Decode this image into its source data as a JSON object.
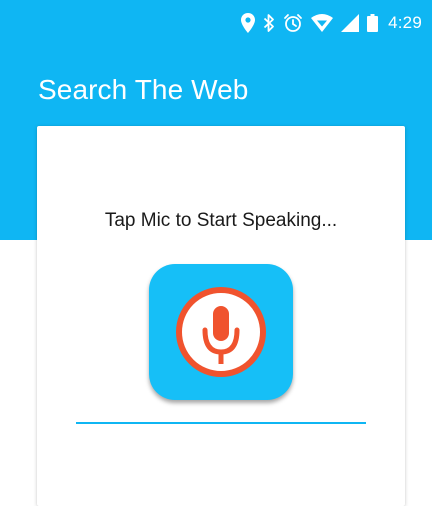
{
  "status_bar": {
    "time": "4:29",
    "icons": [
      "location-icon",
      "bluetooth-icon",
      "alarm-icon",
      "wifi-icon",
      "cell-signal-icon",
      "battery-icon"
    ]
  },
  "app_bar": {
    "title": "Search The Web"
  },
  "voice_card": {
    "prompt": "Tap Mic to Start Speaking...",
    "mic_icon": "microphone-icon"
  },
  "colors": {
    "primary": "#0fb6f3",
    "mic_tile": "#16bff7",
    "mic_ring": "#f0532e",
    "card": "#ffffff"
  }
}
